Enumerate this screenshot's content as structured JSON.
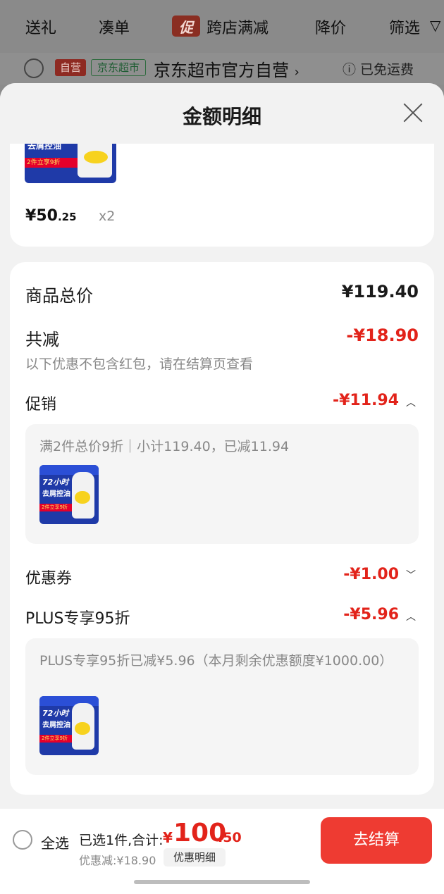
{
  "background": {
    "filters": [
      "送礼",
      "凑单",
      "跨店满减",
      "降价",
      "筛选"
    ],
    "promo_chip": "促",
    "store": {
      "tag_ziying": "自营",
      "tag_supermarket": "京东超市",
      "name": "京东超市官方自营",
      "chevron": "›",
      "free_shipping": "ⓘ 已免运费"
    }
  },
  "sheet": {
    "title": "金额明细",
    "product": {
      "thumb_text_1": "72小时",
      "thumb_text_2": "去屑控油",
      "thumb_band": "2件立享9折",
      "price_symbol": "¥",
      "price_int": "50",
      "price_dec": ".25",
      "qty": "x2"
    },
    "summary": {
      "total_label": "商品总价",
      "total_value": "¥119.40",
      "reduce_label": "共减",
      "reduce_value": "-¥18.90",
      "note": "以下优惠不包含红包，请在结算页查看"
    },
    "promotion": {
      "label": "促销",
      "value": "-¥11.94",
      "detail": "满2件总价9折｜小计119.40，已减11.94"
    },
    "coupon": {
      "label": "优惠券",
      "value": "-¥1.00"
    },
    "plus": {
      "label": "PLUS专享95折",
      "value": "-¥5.96",
      "detail": "PLUS专享95折已减¥5.96（本月剩余优惠额度¥1000.00）"
    }
  },
  "bottom_bar": {
    "select_all": "全选",
    "selected_text": "已选1件,合计:",
    "currency": "¥",
    "total_int": "100",
    "total_dec": ".50",
    "discount_text": "优惠减:¥18.90",
    "detail_button": "优惠明细",
    "checkout_button": "去结算"
  },
  "colors": {
    "accent_red": "#e2231a",
    "checkout_bg": "#ee3b32"
  }
}
